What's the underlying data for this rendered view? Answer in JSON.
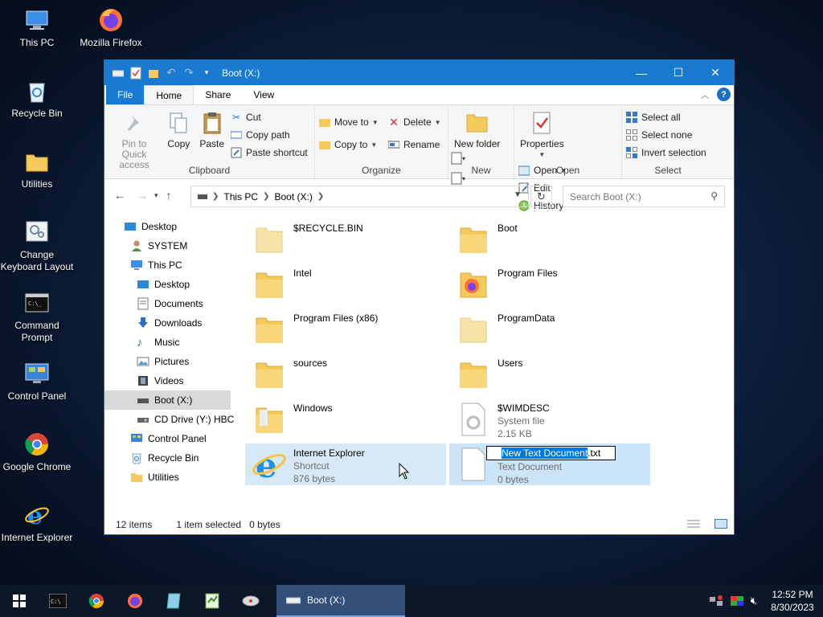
{
  "desktop": {
    "icons": [
      {
        "label": "This PC"
      },
      {
        "label": "Mozilla Firefox"
      },
      {
        "label": "Recycle Bin"
      },
      {
        "label": "Utilities"
      },
      {
        "label": "Change Keyboard Layout"
      },
      {
        "label": "Command Prompt"
      },
      {
        "label": "Control Panel"
      },
      {
        "label": "Google Chrome"
      },
      {
        "label": "Internet Explorer"
      }
    ]
  },
  "window": {
    "title": "Boot (X:)",
    "controls": {
      "minimize": "—",
      "maximize": "☐",
      "close": "✕"
    }
  },
  "ribbon_tabs": {
    "file": "File",
    "home": "Home",
    "share": "Share",
    "view": "View",
    "help": "?"
  },
  "ribbon": {
    "clipboard": {
      "label": "Clipboard",
      "pin": "Pin to Quick access",
      "copy": "Copy",
      "paste": "Paste",
      "cut": "Cut",
      "copy_path": "Copy path",
      "paste_shortcut": "Paste shortcut"
    },
    "organize": {
      "label": "Organize",
      "move_to": "Move to",
      "copy_to": "Copy to",
      "delete": "Delete",
      "rename": "Rename"
    },
    "new": {
      "label": "New",
      "new_folder": "New folder"
    },
    "open": {
      "label": "Open",
      "properties": "Properties",
      "open": "Open",
      "edit": "Edit",
      "history": "History"
    },
    "select": {
      "label": "Select",
      "select_all": "Select all",
      "select_none": "Select none",
      "invert": "Invert selection"
    }
  },
  "address": {
    "crumbs": [
      "This PC",
      "Boot (X:)"
    ],
    "search_placeholder": "Search Boot (X:)"
  },
  "nav": {
    "items": [
      {
        "label": "Desktop"
      },
      {
        "label": "SYSTEM"
      },
      {
        "label": "This PC"
      },
      {
        "label": "Desktop"
      },
      {
        "label": "Documents"
      },
      {
        "label": "Downloads"
      },
      {
        "label": "Music"
      },
      {
        "label": "Pictures"
      },
      {
        "label": "Videos"
      },
      {
        "label": "Boot (X:)"
      },
      {
        "label": "CD Drive (Y:) HBC"
      },
      {
        "label": "Control Panel"
      },
      {
        "label": "Recycle Bin"
      },
      {
        "label": "Utilities"
      }
    ]
  },
  "files": {
    "items": [
      {
        "name": "$RECYCLE.BIN"
      },
      {
        "name": "Boot"
      },
      {
        "name": "Intel"
      },
      {
        "name": "Program Files"
      },
      {
        "name": "Program Files (x86)"
      },
      {
        "name": "ProgramData"
      },
      {
        "name": "sources"
      },
      {
        "name": "Users"
      },
      {
        "name": "Windows"
      },
      {
        "name": "$WIMDESC",
        "type": "System file",
        "size": "2.15 KB"
      },
      {
        "name": "Internet Explorer",
        "type": "Shortcut",
        "size": "876 bytes"
      },
      {
        "name_selected": "New Text Document",
        "name_rest": ".txt",
        "type": "Text Document",
        "size": "0 bytes"
      }
    ]
  },
  "status": {
    "count": "12 items",
    "selected": "1 item selected",
    "size": "0 bytes"
  },
  "taskbar": {
    "active_label": "Boot (X:)",
    "time": "12:52 PM",
    "date": "8/30/2023"
  },
  "colors": {
    "titlebar": "#1a7ad0",
    "selection": "#d7e9f8",
    "folder": "#f4c95e",
    "taskbar": "#0b1628"
  }
}
